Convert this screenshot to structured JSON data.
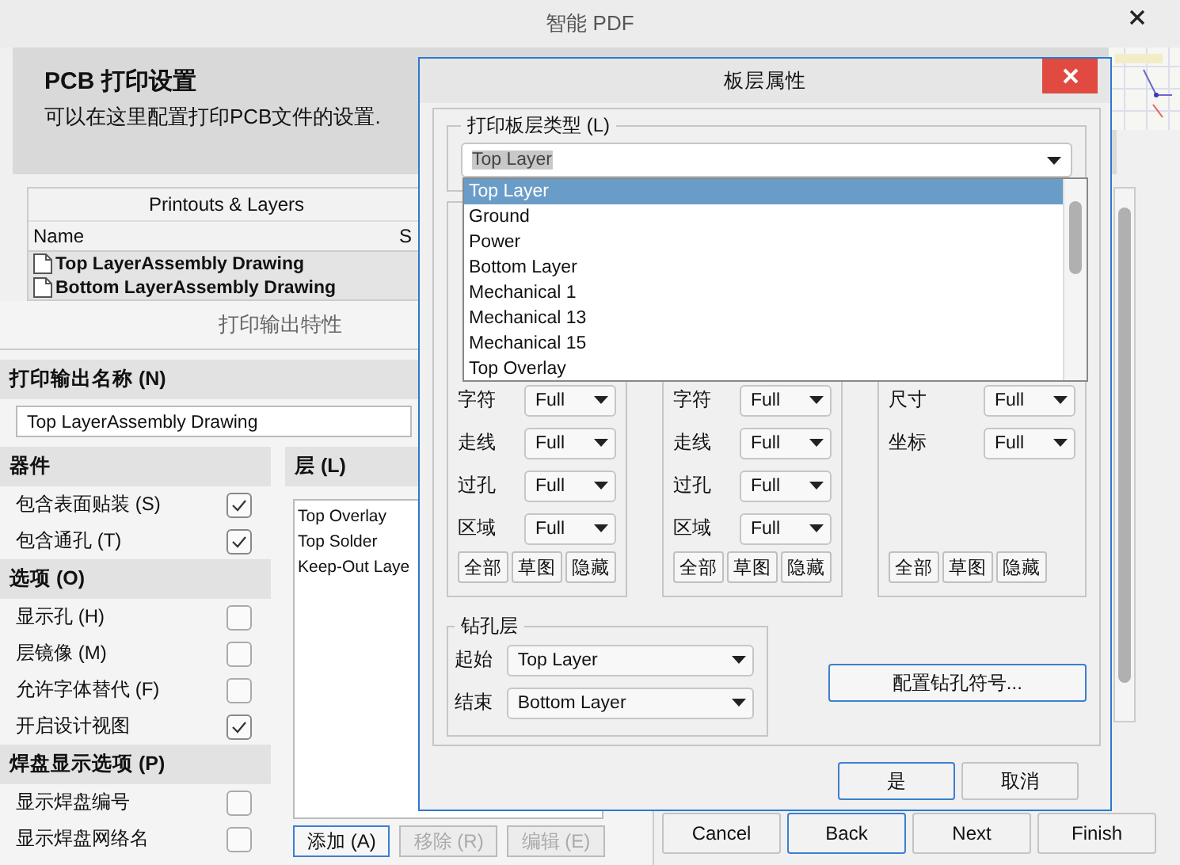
{
  "main_window": {
    "title": "智能 PDF"
  },
  "header": {
    "title": "PCB 打印设置",
    "subtitle": "可以在这里配置打印PCB文件的设置."
  },
  "printouts_table": {
    "heading": "Printouts & Layers",
    "columns": [
      "Name",
      "S"
    ],
    "rows": [
      {
        "name": "Top LayerAssembly Drawing"
      },
      {
        "name": "Bottom LayerAssembly Drawing"
      }
    ]
  },
  "properties": {
    "title": "打印输出特性",
    "name_label": "打印输出名称 (N)",
    "name_value": "Top LayerAssembly Drawing",
    "sections": [
      {
        "heading": "器件",
        "options": [
          {
            "label": "包含表面贴装 (S)",
            "checked": true
          },
          {
            "label": "包含通孔 (T)",
            "checked": true
          }
        ]
      },
      {
        "heading": "选项 (O)",
        "options": [
          {
            "label": "显示孔 (H)",
            "checked": false
          },
          {
            "label": "层镜像 (M)",
            "checked": false
          },
          {
            "label": "允许字体替代 (F)",
            "checked": false
          },
          {
            "label": "开启设计视图",
            "checked": true
          }
        ]
      },
      {
        "heading": "焊盘显示选项 (P)",
        "options": [
          {
            "label": "显示焊盘编号",
            "checked": false
          },
          {
            "label": "显示焊盘网络名",
            "checked": false
          }
        ]
      }
    ],
    "layers": {
      "heading": "层 (L)",
      "items": [
        "Top Overlay",
        "Top Solder",
        "Keep-Out Laye"
      ],
      "buttons": [
        {
          "label": "添加 (A)",
          "disabled": false
        },
        {
          "label": "移除 (R)",
          "disabled": true
        },
        {
          "label": "编辑 (E)",
          "disabled": true
        }
      ]
    }
  },
  "wizard_buttons": [
    {
      "label": "Cancel",
      "default": false
    },
    {
      "label": "Back",
      "default": true
    },
    {
      "label": "Next",
      "default": false
    },
    {
      "label": "Finish",
      "default": false
    }
  ],
  "dialog": {
    "title": "板层属性",
    "layer_type": {
      "label": "打印板层类型 (L)",
      "value": "Top Layer",
      "options": [
        {
          "label": "Top Layer",
          "selected": true
        },
        {
          "label": "Ground",
          "selected": false
        },
        {
          "label": "Power",
          "selected": false
        },
        {
          "label": "Bottom Layer",
          "selected": false
        },
        {
          "label": "Mechanical 1",
          "selected": false
        },
        {
          "label": "Mechanical 13",
          "selected": false
        },
        {
          "label": "Mechanical 15",
          "selected": false
        },
        {
          "label": "Top Overlay",
          "selected": false
        }
      ]
    },
    "groups": [
      {
        "rows": [
          {
            "label": "字符",
            "value": "Full"
          },
          {
            "label": "走线",
            "value": "Full"
          },
          {
            "label": "过孔",
            "value": "Full"
          },
          {
            "label": "区域",
            "value": "Full"
          }
        ],
        "buttons": [
          "全部",
          "草图",
          "隐藏"
        ]
      },
      {
        "rows": [
          {
            "label": "字符",
            "value": "Full"
          },
          {
            "label": "走线",
            "value": "Full"
          },
          {
            "label": "过孔",
            "value": "Full"
          },
          {
            "label": "区域",
            "value": "Full"
          }
        ],
        "buttons": [
          "全部",
          "草图",
          "隐藏"
        ]
      },
      {
        "rows": [
          {
            "label": "尺寸",
            "value": "Full"
          },
          {
            "label": "坐标",
            "value": "Full"
          }
        ],
        "buttons": [
          "全部",
          "草图",
          "隐藏"
        ]
      }
    ],
    "drill": {
      "heading": "钻孔层",
      "rows": [
        {
          "label": "起始",
          "value": "Top Layer"
        },
        {
          "label": "结束",
          "value": "Bottom Layer"
        }
      ]
    },
    "drill_symbols_button": "配置钻孔符号...",
    "buttons": [
      "是",
      "取消"
    ]
  }
}
